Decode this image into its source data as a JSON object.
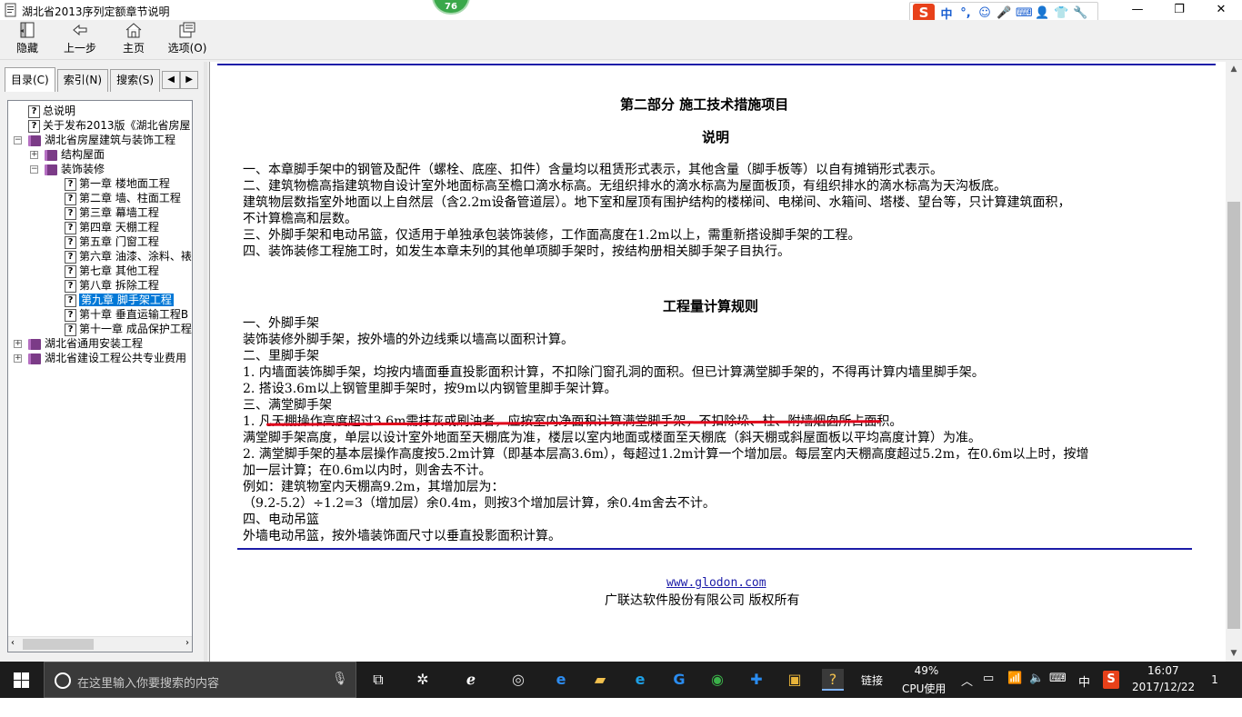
{
  "window": {
    "title": "湖北省2013序列定额章节说明",
    "badge": "76",
    "controls": {
      "minimize": "—",
      "maximize": "❐",
      "close": "✕"
    }
  },
  "ime": {
    "logo": "S",
    "items": [
      "中",
      "°,",
      "☺",
      "🎤",
      "⌨",
      "👤",
      "👕",
      "🔧"
    ]
  },
  "toolbar": {
    "hide": "隐藏",
    "back": "上一步",
    "home": "主页",
    "options": "选项(O)"
  },
  "tabs": [
    "目录(C)",
    "索引(N)",
    "搜索(S)"
  ],
  "tree": [
    {
      "label": "总说明",
      "kind": "page",
      "indent": 0
    },
    {
      "label": "关于发布2013版《湖北省房屋",
      "kind": "page",
      "indent": 0
    },
    {
      "label": "湖北省房屋建筑与装饰工程",
      "kind": "book",
      "indent": 0,
      "exp": "⊟"
    },
    {
      "label": "结构屋面",
      "kind": "book",
      "indent": 1,
      "exp": "⊞"
    },
    {
      "label": "装饰装修",
      "kind": "book",
      "indent": 1,
      "exp": "⊟"
    },
    {
      "label": "第一章  楼地面工程",
      "kind": "page",
      "indent": 2
    },
    {
      "label": "第二章  墙、柱面工程",
      "kind": "page",
      "indent": 2
    },
    {
      "label": "第三章  幕墙工程",
      "kind": "page",
      "indent": 2
    },
    {
      "label": "第四章  天棚工程",
      "kind": "page",
      "indent": 2
    },
    {
      "label": "第五章  门窗工程",
      "kind": "page",
      "indent": 2
    },
    {
      "label": "第六章  油漆、涂料、裱",
      "kind": "page",
      "indent": 2
    },
    {
      "label": "第七章  其他工程",
      "kind": "page",
      "indent": 2
    },
    {
      "label": "第八章  拆除工程",
      "kind": "page",
      "indent": 2
    },
    {
      "label": "第九章  脚手架工程",
      "kind": "page",
      "indent": 2,
      "selected": true
    },
    {
      "label": "第十章  垂直运输工程B",
      "kind": "page",
      "indent": 2
    },
    {
      "label": "第十一章  成品保护工程",
      "kind": "page",
      "indent": 2
    },
    {
      "label": "湖北省通用安装工程",
      "kind": "book",
      "indent": 0,
      "exp": "⊞"
    },
    {
      "label": "湖北省建设工程公共专业费用",
      "kind": "book",
      "indent": 0,
      "exp": "⊞"
    }
  ],
  "content": {
    "part_title": "第二部分  施工技术措施项目",
    "explain_title": "说明",
    "explain_lines": [
      "一、本章脚手架中的钢管及配件（螺栓、底座、扣件）含量均以租赁形式表示，其他含量（脚手板等）以自有摊销形式表示。",
      "二、建筑物檐高指建筑物自设计室外地面标高至檐口滴水标高。无组织排水的滴水标高为屋面板顶，有组织排水的滴水标高为天沟板底。",
      "建筑物层数指室外地面以上自然层（含2.2m设备管道层）。地下室和屋顶有围护结构的楼梯间、电梯间、水箱间、塔楼、望台等，只计算建筑面积，",
      "不计算檐高和层数。",
      "三、外脚手架和电动吊篮，仅适用于单独承包装饰装修，工作面高度在1.2m以上，需重新搭设脚手架的工程。",
      "四、装饰装修工程施工时，如发生本章未列的其他单项脚手架时，按结构册相关脚手架子目执行。"
    ],
    "rules_title": "工程量计算规则",
    "rules_lines": [
      "一、外脚手架",
      "装饰装修外脚手架，按外墙的外边线乘以墙高以面积计算。",
      "二、里脚手架",
      "1. 内墙面装饰脚手架，均按内墙面垂直投影面积计算，不扣除门窗孔洞的面积。但已计算满堂脚手架的，不得再计算内墙里脚手架。",
      "2. 搭设3.6m以上钢管里脚手架时，按9m以内钢管里脚手架计算。",
      "三、满堂脚手架",
      "1. 凡天棚操作高度超过3.6m需抹灰或刷油者，应按室内净面积计算满堂脚手架，不扣除垛、柱、附墙烟囱所占面积。",
      "满堂脚手架高度，单层以设计室外地面至天棚底为准，楼层以室内地面或楼面至天棚底（斜天棚或斜屋面板以平均高度计算）为准。",
      "2. 满堂脚手架的基本层操作高度按5.2m计算（即基本层高3.6m），每超过1.2m计算一个增加层。每层室内天棚高度超过5.2m，在0.6m以上时，按增",
      "加一层计算；在0.6m以内时，则舍去不计。",
      "例如：建筑物室内天棚高9.2m，其增加层为：",
      "（9.2-5.2）÷1.2=3（增加层）余0.4m，则按3个增加层计算，余0.4m舍去不计。",
      "四、电动吊篮",
      "外墙电动吊篮，按外墙装饰面尺寸以垂直投影面积计算。"
    ],
    "footer_link": "www.glodon.com",
    "footer_copyright": "广联达软件股份有限公司 版权所有"
  },
  "taskbar": {
    "search_placeholder": "在这里输入你要搜索的内容",
    "links_label": "链接",
    "cpu_percent": "49%",
    "cpu_label": "CPU使用",
    "ime_lang": "中",
    "time": "16:07",
    "date": "2017/12/22",
    "notifications": "1"
  },
  "colors": {
    "accent": "#0078d7",
    "rule_blue": "#1c1ca8",
    "annotation_red": "#e0001a"
  }
}
